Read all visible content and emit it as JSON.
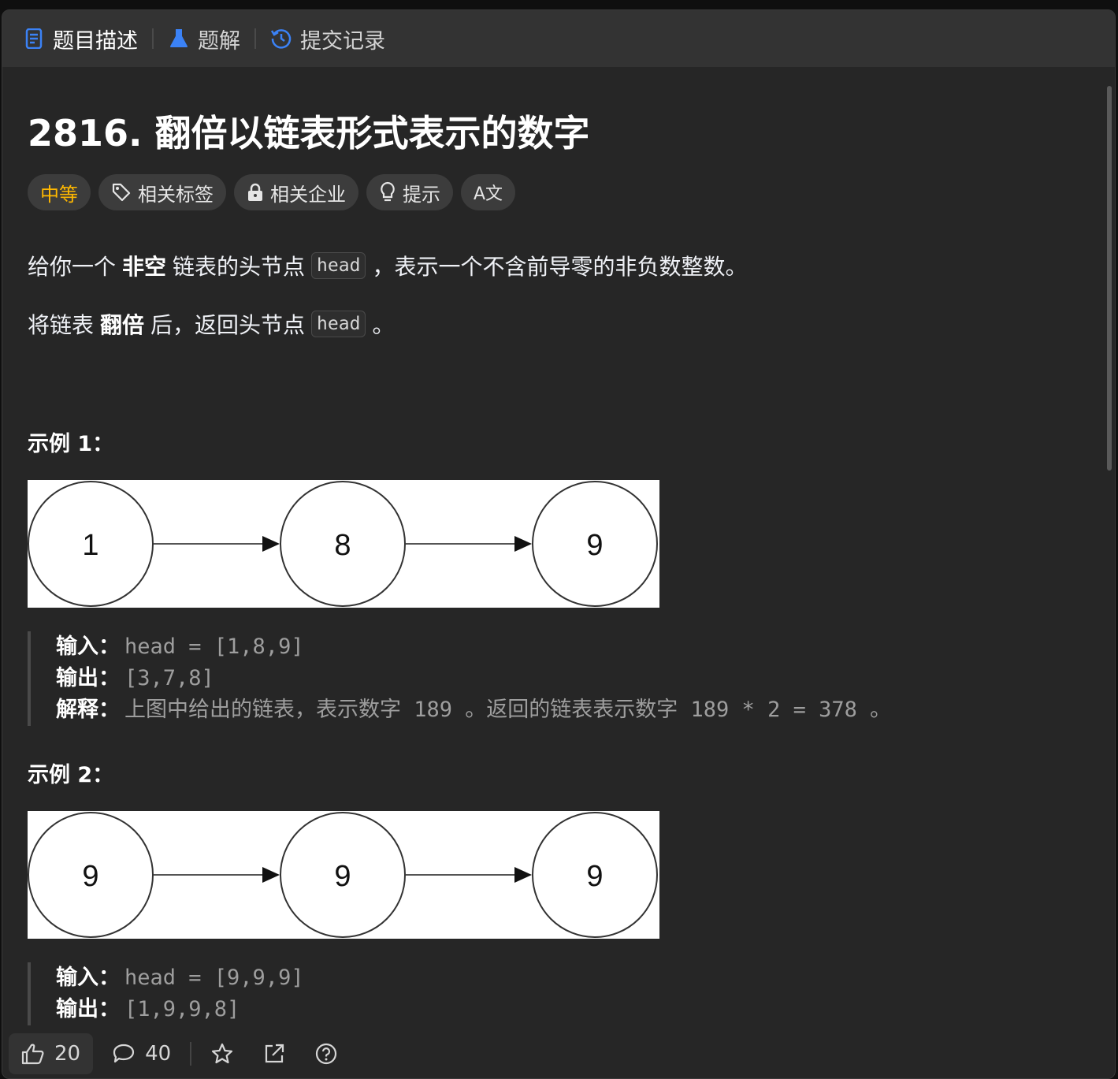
{
  "tabs": [
    {
      "label": "题目描述",
      "icon": "description-icon"
    },
    {
      "label": "题解",
      "icon": "flask-icon"
    },
    {
      "label": "提交记录",
      "icon": "history-icon"
    }
  ],
  "problem": {
    "title": "2816. 翻倍以链表形式表示的数字",
    "difficulty": "中等",
    "tags": [
      "相关标签",
      "相关企业",
      "提示"
    ],
    "translate_label": "A文"
  },
  "description": {
    "p1": {
      "a": "给你一个",
      "b": "非空",
      "c": "链表的头节点",
      "code": "head",
      "d": "，表示一个不含前导零的非负数整数。"
    },
    "p2": {
      "a": "将链表",
      "b": "翻倍",
      "c": "后，返回头节点",
      "code": "head",
      "d": "。"
    }
  },
  "examples": [
    {
      "heading": "示例 1：",
      "nodes": [
        "1",
        "8",
        "9"
      ],
      "input_label": "输入：",
      "input": "head = [1,8,9]",
      "output_label": "输出：",
      "output": "[3,7,8]",
      "explain_label": "解释：",
      "explain_a": "上图中给出的链表，表示数字",
      "explain_b": " 189 ",
      "explain_c": "。返回的链表表示数字",
      "explain_d": " 189 * 2 = 378 ",
      "explain_e": "。"
    },
    {
      "heading": "示例 2：",
      "nodes": [
        "9",
        "9",
        "9"
      ],
      "input_label": "输入：",
      "input": "head = [9,9,9]",
      "output_label": "输出：",
      "output": "[1,9,9,8]"
    }
  ],
  "footer": {
    "likes": "20",
    "comments": "40"
  },
  "colors": {
    "difficulty": "#ffb800",
    "accent": "#3b82f6"
  }
}
